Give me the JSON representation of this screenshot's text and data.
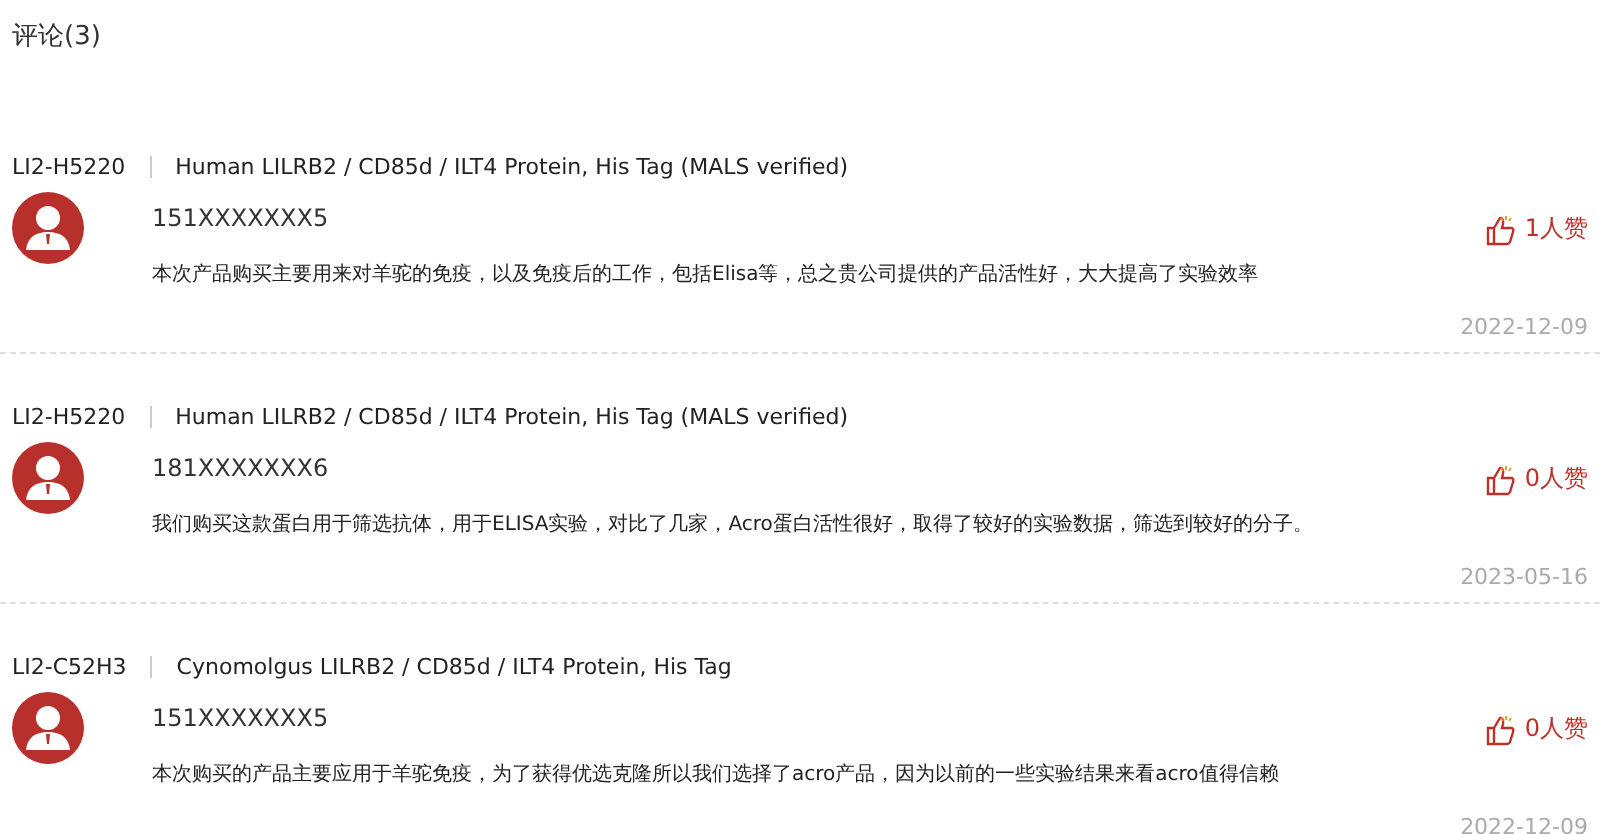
{
  "title": "评论(3)",
  "comments": [
    {
      "code": "LI2-H5220",
      "product": "Human LILRB2 / CD85d / ILT4 Protein, His Tag (MALS verified)",
      "user": "151XXXXXXX5",
      "likes": "1人赞",
      "text": "本次产品购买主要用来对羊驼的免疫，以及免疫后的工作，包括Elisa等，总之贵公司提供的产品活性好，大大提高了实验效率",
      "date": "2022-12-09"
    },
    {
      "code": "LI2-H5220",
      "product": "Human LILRB2 / CD85d / ILT4 Protein, His Tag (MALS verified)",
      "user": "181XXXXXXX6",
      "likes": "0人赞",
      "text": "我们购买这款蛋白用于筛选抗体，用于ELISA实验，对比了几家，Acro蛋白活性很好，取得了较好的实验数据，筛选到较好的分子。",
      "date": "2023-05-16"
    },
    {
      "code": "LI2-C52H3",
      "product": "Cynomolgus LILRB2 / CD85d / ILT4 Protein, His Tag",
      "user": "151XXXXXXX5",
      "likes": "0人赞",
      "text": "本次购买的产品主要应用于羊驼免疫，为了获得优选克隆所以我们选择了acro产品，因为以前的一些实验结果来看acro值得信赖",
      "date": "2022-12-09"
    }
  ]
}
